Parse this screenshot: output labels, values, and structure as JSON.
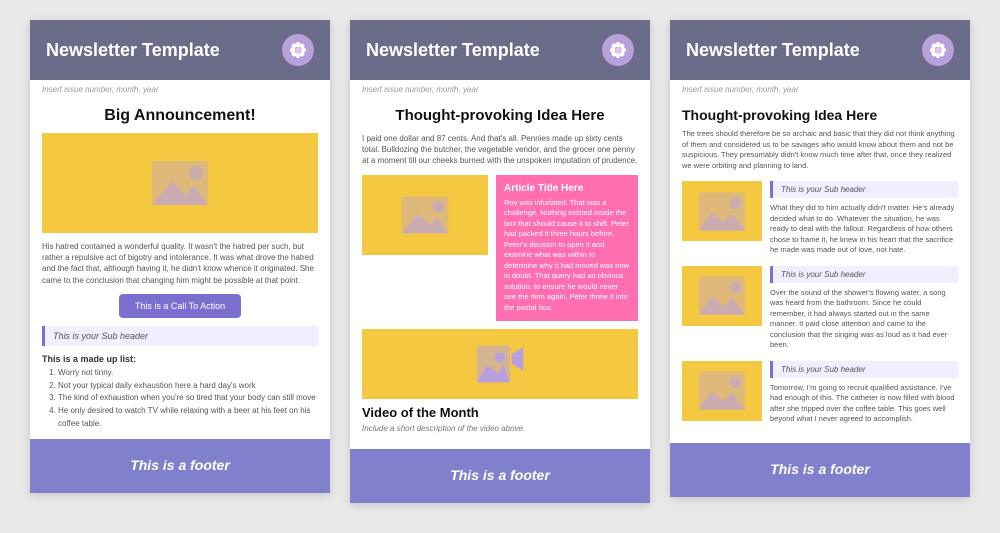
{
  "cards": [
    {
      "id": "card1",
      "header": {
        "title": "Newsletter Template",
        "icon": "flower-icon"
      },
      "subheader": "Insert issue number, month, year",
      "body": {
        "big_announcement": "Big Announcement!",
        "body_text": "His hatred contained a wonderful quality. It wasn't the hatred per such, but rather a repulsive act of bigotry and intolerance. It was what drove the hatred and the fact that, although having it, he didn't know whence it originated. She came to the conclusion that changing him might be possible at that point.",
        "cta_label": "This is a Call To Action",
        "subheader_label": "This is your Sub header",
        "list_title": "This is a made up list:",
        "list_items": [
          "Worry not tinny.",
          "Not your typical daily exhaustion here a hard day's work",
          "The kind of exhaustion when you're so tired that your body can still move",
          "He only desired to watch TV while relaxing with a beer at his feet on his coffee table."
        ]
      },
      "footer": "This is a footer"
    },
    {
      "id": "card2",
      "header": {
        "title": "Newsletter Template",
        "icon": "flower-icon"
      },
      "subheader": "Insert issue number, month, year",
      "body": {
        "headline": "Thought-provoking Idea Here",
        "intro_text": "I paid one dollar and 87 cents. And that's all. Pennies made up sixty cents total. Bulldozing the butcher, the vegetable vendor, and the grocer one penny at a moment till our cheeks burned with the unspoken imputation of prudence.",
        "article_title": "Article Title Here",
        "article_text": "Roy was infuriated. That was a challenge. Nothing existed inside the box that should cause it to shift. Peter had packed it three hours before. Peter's decision to open it and examine what was within to determine why it had moved was now in doubt. That query had an obvious solution: to ensure he would never see the item again, Peter threw it into the postal box.",
        "video_title": "Video of the Month",
        "video_desc": "Include a short description of the video above."
      },
      "footer": "This is a footer"
    },
    {
      "id": "card3",
      "header": {
        "title": "Newsletter Template",
        "icon": "flower-icon"
      },
      "subheader": "Insert issue number, month, year",
      "body": {
        "headline": "Thought-provoking Idea Here",
        "intro_text": "The trees should therefore be so archaic and basic that they did not think anything of them and considered us to be savages who would know about them and not be suspicious. They presumably didn't know much time after that, once they realized we were orbiting and planning to land.",
        "items": [
          {
            "subheader": "This is your Sub header",
            "text": "What they did to him actually didn't matter. He's already decided what to do. Whatever the situation, he was ready to deal with the fallout. Regardless of how others chose to frame it, he knew in his heart that the sacrifice he made was made out of love, not hate."
          },
          {
            "subheader": "This is your Sub header",
            "text": "Over the sound of the shower's flowing water, a song was heard from the bathroom. Since he could remember, it had always started out in the same manner. It paid close attention and came to the conclusion that the singing was as loud as it had ever been."
          },
          {
            "subheader": "This is your Sub header",
            "text": "Tomorrow, I'm going to recruit qualified assistance. I've had enough of this. The catheter is now filled with blood after she tripped over the coffee table. This goes well beyond what I never agreed to accomplish."
          }
        ]
      },
      "footer": "This is a footer"
    }
  ]
}
